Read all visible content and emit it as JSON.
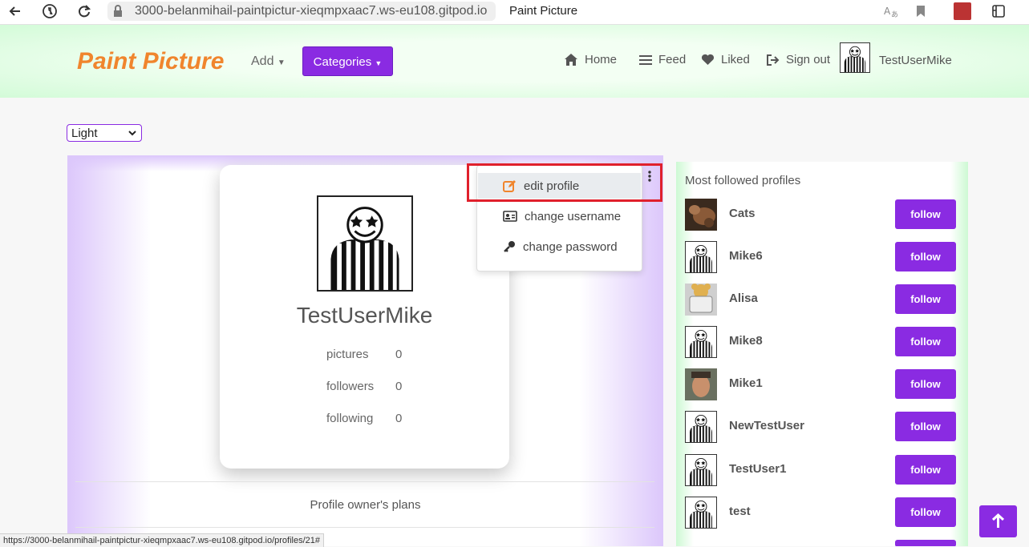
{
  "browser": {
    "url": "3000-belanmihail-paintpictur-xieqmpxaac7.ws-eu108.gitpod.io",
    "tab_title": "Paint Picture"
  },
  "header": {
    "brand": "Paint Picture",
    "add_label": "Add",
    "categories_label": "Categories",
    "nav": [
      {
        "label": "Home",
        "icon": "home-icon"
      },
      {
        "label": "Feed",
        "icon": "feed-icon"
      },
      {
        "label": "Liked",
        "icon": "heart-icon"
      },
      {
        "label": "Sign out",
        "icon": "sign-out-icon"
      }
    ],
    "username": "TestUserMike"
  },
  "theme": {
    "selected": "Light"
  },
  "profile": {
    "username": "TestUserMike",
    "stats": [
      {
        "label": "pictures",
        "value": "0"
      },
      {
        "label": "followers",
        "value": "0"
      },
      {
        "label": "following",
        "value": "0"
      }
    ],
    "plans_label": "Profile owner's plans"
  },
  "dropdown": {
    "items": [
      {
        "label": "edit profile",
        "icon": "edit-icon",
        "active": true
      },
      {
        "label": "change username",
        "icon": "id-card-icon",
        "active": false
      },
      {
        "label": "change password",
        "icon": "key-icon",
        "active": false
      }
    ]
  },
  "sidebar": {
    "title": "Most followed profiles",
    "follow_label": "follow",
    "profiles": [
      {
        "name": "Cats",
        "avatar": "cat-photo"
      },
      {
        "name": "Mike6",
        "avatar": "striped-figure"
      },
      {
        "name": "Alisa",
        "avatar": "bear-photo"
      },
      {
        "name": "Mike8",
        "avatar": "striped-figure"
      },
      {
        "name": "Mike1",
        "avatar": "face-photo"
      },
      {
        "name": "NewTestUser",
        "avatar": "striped-figure"
      },
      {
        "name": "TestUser1",
        "avatar": "striped-figure"
      },
      {
        "name": "test",
        "avatar": "striped-figure"
      }
    ]
  },
  "statusbar": {
    "text": "https://3000-belanmihail-paintpictur-xieqmpxaac7.ws-eu108.gitpod.io/profiles/21#"
  },
  "colors": {
    "accent": "#8a2be2",
    "brand": "#f0852d",
    "highlight": "#e0202c"
  }
}
